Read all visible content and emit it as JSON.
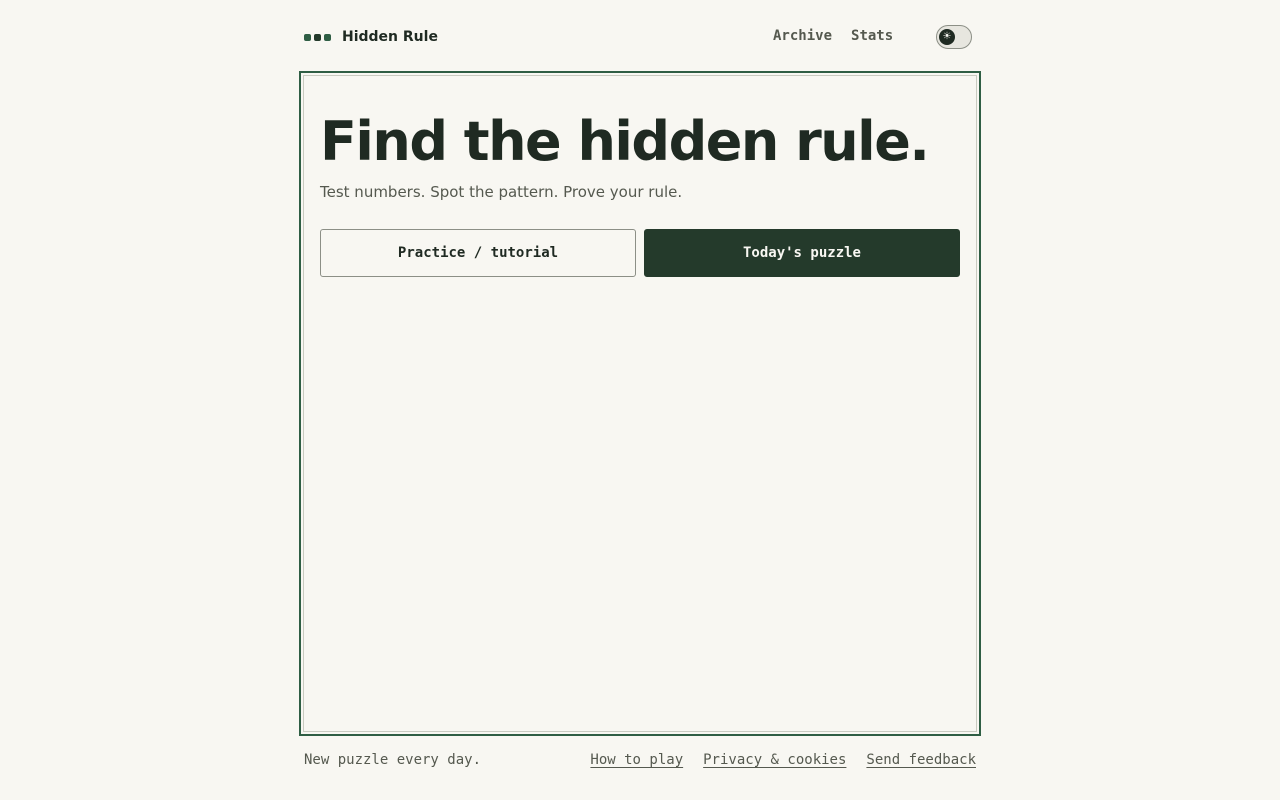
{
  "header": {
    "brand": "Hidden Rule",
    "logo_icon": "three-dots-logo",
    "nav": [
      {
        "label": "Archive"
      },
      {
        "label": "Stats"
      }
    ],
    "theme_toggle_icon": "☀",
    "theme_toggle_state": "light"
  },
  "hero": {
    "title": "Find the hidden rule.",
    "subtitle": "Test numbers. Spot the pattern. Prove your rule.",
    "practice_label": "Practice / tutorial",
    "today_label": "Today's puzzle"
  },
  "footer": {
    "tagline": "New puzzle every day.",
    "links": [
      {
        "label": "How to play"
      },
      {
        "label": "Privacy & cookies"
      },
      {
        "label": "Send feedback"
      }
    ]
  },
  "colors": {
    "accent": "#2f5e44",
    "primary_button": "#243a2b",
    "background": "#f8f7f2",
    "text": "#1f2a22",
    "muted_text": "#55594f"
  }
}
